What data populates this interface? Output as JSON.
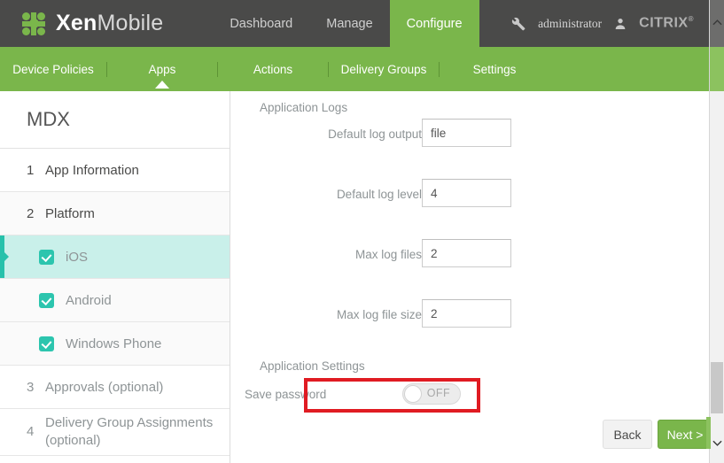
{
  "header": {
    "brand_bold": "Xen",
    "brand_light": "Mobile",
    "logo_icon": "xenmobile-dots-logo",
    "nav": [
      {
        "label": "Dashboard",
        "active": false
      },
      {
        "label": "Manage",
        "active": false
      },
      {
        "label": "Configure",
        "active": true
      }
    ],
    "wrench_icon": "wrench-icon",
    "account_name": "administrator",
    "person_icon": "person-icon",
    "vendor": "CITRIX",
    "vendor_tm": "®"
  },
  "subnav": {
    "items": [
      {
        "label": "Device Policies",
        "active": false
      },
      {
        "label": "Apps",
        "active": true
      },
      {
        "label": "Actions",
        "active": false
      },
      {
        "label": "Delivery Groups",
        "active": false
      },
      {
        "label": "Settings",
        "active": false
      }
    ]
  },
  "sidebar": {
    "title": "MDX",
    "steps": [
      {
        "num": "1",
        "label": "App Information"
      },
      {
        "num": "2",
        "label": "Platform"
      },
      {
        "num": "3",
        "label": "Approvals (optional)"
      },
      {
        "num": "4",
        "label": "Delivery Group Assignments (optional)"
      }
    ],
    "platforms": [
      {
        "label": "iOS",
        "checked": true,
        "selected": true
      },
      {
        "label": "Android",
        "checked": true,
        "selected": false
      },
      {
        "label": "Windows Phone",
        "checked": true,
        "selected": false
      }
    ]
  },
  "main": {
    "sections": [
      {
        "title": "Application Logs"
      },
      {
        "title": "Application Settings"
      }
    ],
    "fields": [
      {
        "label": "Default log output",
        "value": "file"
      },
      {
        "label": "Default log level",
        "value": "4"
      },
      {
        "label": "Max log files",
        "value": "2"
      },
      {
        "label": "Max log file size",
        "value": "2"
      }
    ],
    "toggle": {
      "label": "Save password",
      "state": "OFF",
      "highlighted": true,
      "highlight_color": "#e01b22"
    },
    "buttons": {
      "back": "Back",
      "next": "Next >"
    }
  },
  "scrollbar": {
    "up_icon": "chevron-up-icon",
    "down_icon": "chevron-down-icon"
  },
  "colors": {
    "brand_green": "#7ab64b",
    "header_dark": "#4a4a49",
    "teal_select": "#c9f0ea",
    "teal_accent": "#27c1ab",
    "highlight_red": "#e01b22"
  }
}
